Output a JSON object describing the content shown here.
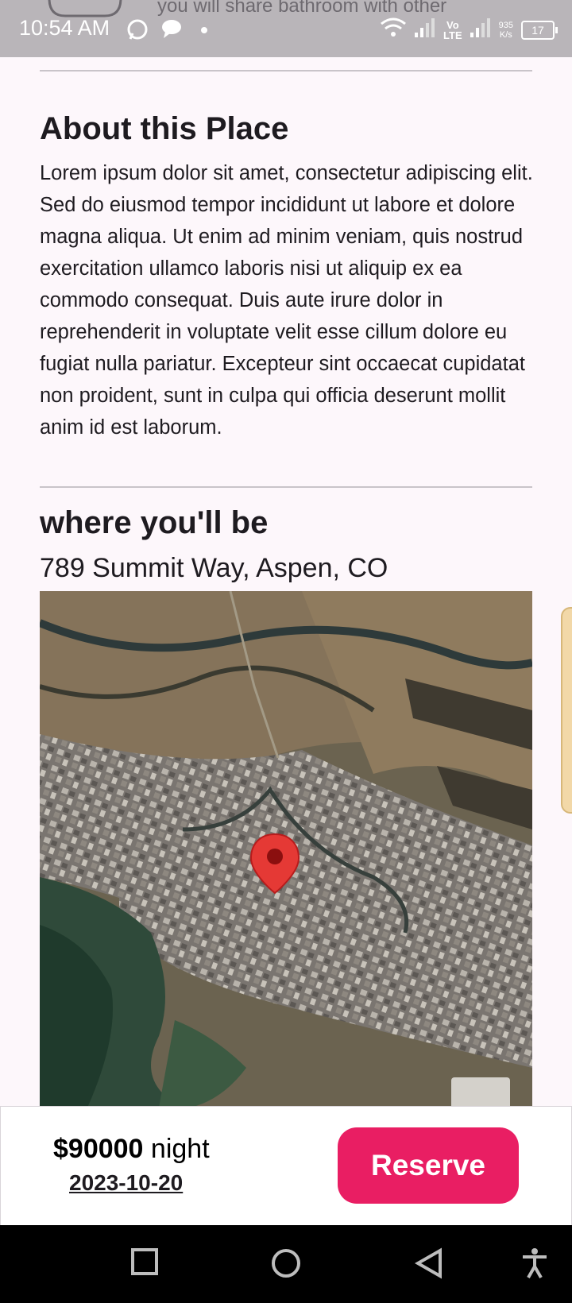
{
  "status_bar": {
    "time": "10:54 AM",
    "peek_text": "you will share bathroom with other",
    "network_speed_value": "935",
    "network_speed_unit": "K/s",
    "volte_top": "Vo",
    "volte_bottom": "LTE",
    "battery": "17"
  },
  "about": {
    "title": "About this Place",
    "body": "Lorem ipsum dolor sit amet, consectetur adipiscing elit. Sed do eiusmod tempor incididunt ut labore et dolore magna aliqua. Ut enim ad minim veniam, quis nostrud exercitation ullamco laboris nisi ut aliquip ex ea commodo consequat. Duis aute irure dolor in reprehenderit in voluptate velit esse cillum dolore eu fugiat nulla pariatur. Excepteur sint occaecat cupidatat non proident, sunt in culpa qui officia deserunt mollit anim id est laborum."
  },
  "location": {
    "title": "where you'll be",
    "address": "789 Summit Way, Aspen, CO"
  },
  "reserve_bar": {
    "price": "$90000",
    "unit": "night",
    "date": "2023-10-20",
    "button_label": "Reserve"
  },
  "colors": {
    "accent": "#e91e63",
    "background": "#fdf7fb",
    "map_marker": "#e53935"
  },
  "icons": {
    "map_marker": "map-pin-icon",
    "nav_recents": "square-icon",
    "nav_home": "circle-icon",
    "nav_back": "triangle-back-icon",
    "accessibility": "accessibility-icon"
  }
}
